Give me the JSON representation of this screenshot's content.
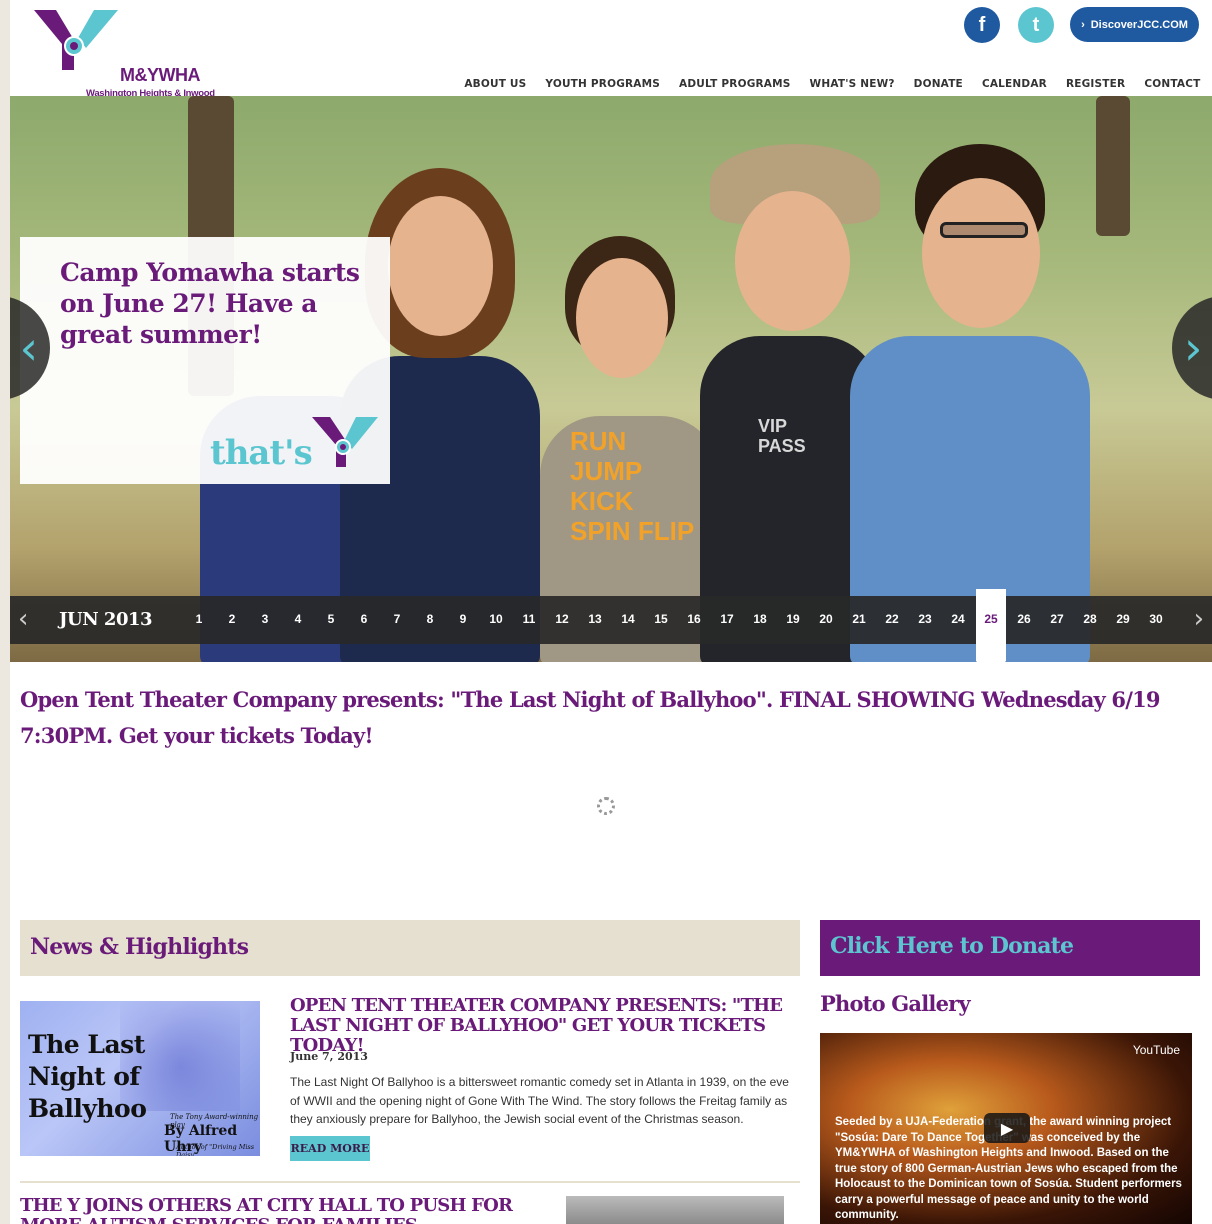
{
  "header": {
    "logo_name": "M&YWHA",
    "logo_sub": "Washington Heights & Inwood",
    "facebook_glyph": "f",
    "twitter_glyph": "t",
    "discover_label": "DiscoverJCC.COM",
    "discover_glyph": "›"
  },
  "nav": {
    "items": [
      "ABOUT US",
      "YOUTH PROGRAMS",
      "ADULT PROGRAMS",
      "WHAT'S NEW?",
      "DONATE",
      "CALENDAR",
      "REGISTER",
      "CONTACT"
    ]
  },
  "hero": {
    "promo_text": "Camp Yomawha starts on June 27! Have a great summer!",
    "tagline": "that's",
    "prev_glyph": "‹",
    "next_glyph": "›",
    "shirt_text_1": "RUN JUMP KICK SPIN FLIP",
    "shirt_text_2": "VIP PASS"
  },
  "datebar": {
    "month": "JUN 2013",
    "days": [
      "1",
      "2",
      "3",
      "4",
      "5",
      "6",
      "7",
      "8",
      "9",
      "10",
      "11",
      "12",
      "13",
      "14",
      "15",
      "16",
      "17",
      "18",
      "19",
      "20",
      "21",
      "22",
      "23",
      "24",
      "25",
      "26",
      "27",
      "28",
      "29",
      "30"
    ],
    "active_day": "25",
    "prev_glyph": "‹",
    "next_glyph": "›"
  },
  "headline": "Open Tent Theater Company presents: \"The Last Night of Ballyhoo\". FINAL SHOWING Wednesday 6/19 7:30PM. Get your tickets Today!",
  "news": {
    "section_title": "News & Highlights",
    "article1": {
      "image_title": "The Last Night of Ballyhoo",
      "image_award": "The Tony Award-winning play",
      "image_author": "By Alfred Uhry",
      "image_author_note": "Author of \"Driving Miss Daisy\"",
      "title": "OPEN TENT THEATER COMPANY PRESENTS: \"THE LAST NIGHT OF BALLYHOO\" GET YOUR TICKETS TODAY!",
      "date": "June 7, 2013",
      "body": "The Last Night Of Ballyhoo is a bittersweet romantic comedy set in Atlanta in 1939, on the eve of WWII and the opening night of Gone With The Wind. The story follows the Freitag family as they anxiously prepare for Ballyhoo, the Jewish social event of the Christmas season.",
      "read_more": "READ MORE"
    },
    "article2": {
      "title": "THE Y JOINS OTHERS AT CITY HALL TO PUSH FOR MORE AUTISM SERVICES FOR FAMILIES"
    }
  },
  "sidebar": {
    "donate_label": "Click Here to Donate",
    "gallery_title": "Photo Gallery",
    "video_source": "YouTube",
    "video_play_glyph": "▶",
    "video_caption": "Seeded by a UJA-Federation grant, the award winning project \"Sosúa: Dare To Dance Together\" was conceived by the YM&YWHA of Washington Heights and Inwood. Based on the true story of 800 German-Austrian Jews who escaped from the Holocaust to the Dominican town of Sosúa. Student performers carry a powerful message of peace and unity to the world community."
  },
  "colors": {
    "brand_purple": "#6a1b7a",
    "brand_teal": "#5cc6d0",
    "facebook_blue": "#1f5aa1",
    "beige": "#e5e0cf"
  },
  "icons": [
    "facebook-icon",
    "twitter-icon",
    "chevron-right-icon",
    "arrow-left-icon",
    "arrow-right-icon",
    "play-icon",
    "loading-spinner-icon"
  ]
}
